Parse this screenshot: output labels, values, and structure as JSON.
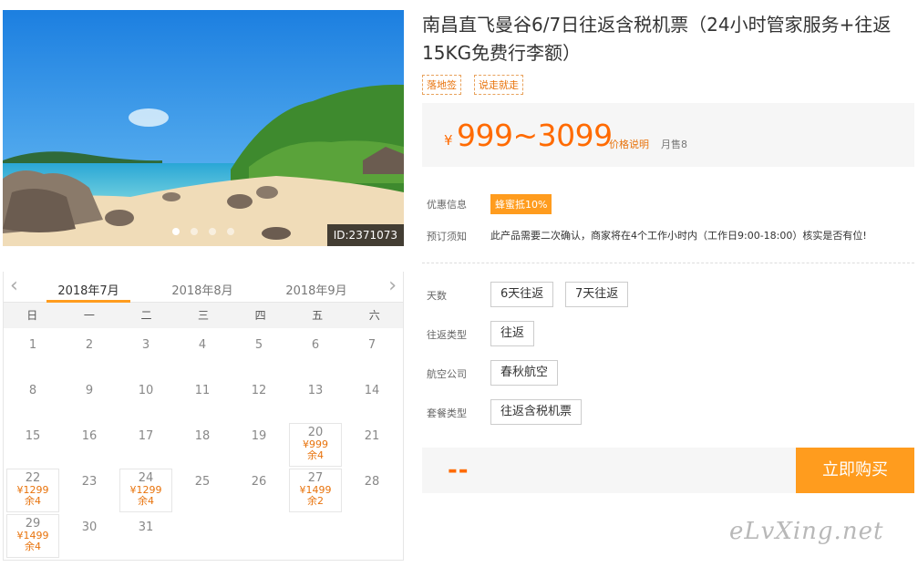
{
  "product": {
    "title": "南昌直飞曼谷6/7日往返含税机票（24小时管家服务+往返15KG免费行李额）",
    "tags": [
      "落地签",
      "说走就走"
    ],
    "id_badge": "ID:2371073",
    "carousel": {
      "count": 4,
      "active_index": 0
    }
  },
  "price": {
    "currency": "¥",
    "range": "999~3099",
    "explain_link": "价格说明",
    "monthly_sales": "月售8"
  },
  "info": {
    "promo_label": "优惠信息",
    "promo_badge": "蜂蜜抵10%",
    "notice_label": "预订须知",
    "notice_text": "此产品需要二次确认，商家将在4个工作小时内（工作日9:00-18:00）核实是否有位!"
  },
  "options": {
    "days_label": "天数",
    "days": [
      "6天往返",
      "7天往返"
    ],
    "trip_label": "往返类型",
    "trip": [
      "往返"
    ],
    "airline_label": "航空公司",
    "airline": [
      "春秋航空"
    ],
    "package_label": "套餐类型",
    "package": [
      "往返含税机票"
    ]
  },
  "purchase": {
    "total": "--",
    "buy_label": "立即购买"
  },
  "calendar": {
    "months": [
      "2018年7月",
      "2018年8月",
      "2018年9月"
    ],
    "active_month": "2018年7月",
    "prev_icon": "‹",
    "next_icon": "›",
    "weekdays": [
      "日",
      "一",
      "二",
      "三",
      "四",
      "五",
      "六"
    ],
    "days": [
      {
        "d": "1"
      },
      {
        "d": "2"
      },
      {
        "d": "3"
      },
      {
        "d": "4"
      },
      {
        "d": "5"
      },
      {
        "d": "6"
      },
      {
        "d": "7"
      },
      {
        "d": "8"
      },
      {
        "d": "9"
      },
      {
        "d": "10"
      },
      {
        "d": "11"
      },
      {
        "d": "12"
      },
      {
        "d": "13"
      },
      {
        "d": "14"
      },
      {
        "d": "15"
      },
      {
        "d": "16"
      },
      {
        "d": "17"
      },
      {
        "d": "18"
      },
      {
        "d": "19"
      },
      {
        "d": "20",
        "price": "¥999",
        "left": "余4"
      },
      {
        "d": "21"
      },
      {
        "d": "22",
        "price": "¥1299",
        "left": "余4"
      },
      {
        "d": "23"
      },
      {
        "d": "24",
        "price": "¥1299",
        "left": "余4"
      },
      {
        "d": "25"
      },
      {
        "d": "26"
      },
      {
        "d": "27",
        "price": "¥1499",
        "left": "余2"
      },
      {
        "d": "28"
      },
      {
        "d": "29",
        "price": "¥1499",
        "left": "余4"
      },
      {
        "d": "30"
      },
      {
        "d": "31"
      }
    ]
  },
  "watermark": "eLvXing.net",
  "colors": {
    "accent": "#ff9c1e",
    "price": "#ff6a00"
  }
}
